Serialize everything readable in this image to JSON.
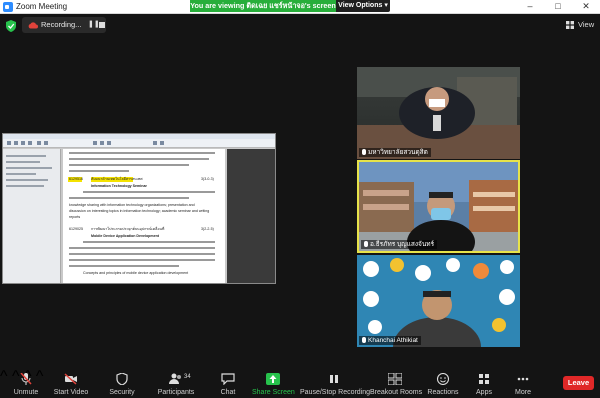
{
  "window": {
    "title": "Zoom Meeting"
  },
  "banner": {
    "text": "You are viewing ติดเฉย แชร์หน้าจอ's screen",
    "view_options": "View Options ▾"
  },
  "recording": {
    "label": "Recording..."
  },
  "view_button": {
    "label": "View"
  },
  "shared_document": {
    "course1_code": "6129516",
    "course1_thai": "สัมมนาด้านเทคโนโลยีสารสนเทศ",
    "course1_credits": "3(3-0-3)",
    "course1_title": "Information Technology Seminar",
    "course2_code": "6129025",
    "course2_thai": "การพัฒนาโปรแกรมประยุกต์บนอุปกรณ์เคลื่อนที่",
    "course2_credits": "3(2-2-5)",
    "course2_title": "Mobile Device Application Development",
    "snippet1": "knowledge sharing with information technology organizations; presentation and",
    "snippet2": "discussion on interesting topics in information technology; academic seminar and writing",
    "snippet3": "reports",
    "snippet4": "Concepts and principles of mobile device application development"
  },
  "participants_tiles": [
    {
      "name": "มหาวิทยาลัยสวนดุสิต"
    },
    {
      "name": "อ.ธีรภัทร บุญแสงจันทร์"
    },
    {
      "name": "Khanchai Athikiat"
    }
  ],
  "toolbar": {
    "unmute": "Unmute",
    "start_video": "Start Video",
    "security": "Security",
    "participants": "Participants",
    "participants_count": "34",
    "chat": "Chat",
    "share_screen": "Share Screen",
    "pause_stop_recording": "Pause/Stop Recording",
    "breakout_rooms": "Breakout Rooms",
    "reactions": "Reactions",
    "apps": "Apps",
    "more": "More",
    "leave": "Leave"
  },
  "colors": {
    "banner_green": "#27ae3a",
    "share_green": "#27c24c",
    "active_speaker": "#e7e34a",
    "leave_red": "#e02828",
    "muted_red": "#e0433b"
  },
  "icons": [
    "zoom-logo-icon",
    "shield-icon",
    "cloud-recording-icon",
    "pause-icon",
    "stop-icon",
    "grid-view-icon",
    "microphone-muted-icon",
    "video-muted-icon",
    "security-shield-icon",
    "participants-icon",
    "chat-icon",
    "share-screen-icon",
    "record-icon",
    "breakout-rooms-icon",
    "reactions-icon",
    "apps-icon",
    "more-icon"
  ]
}
